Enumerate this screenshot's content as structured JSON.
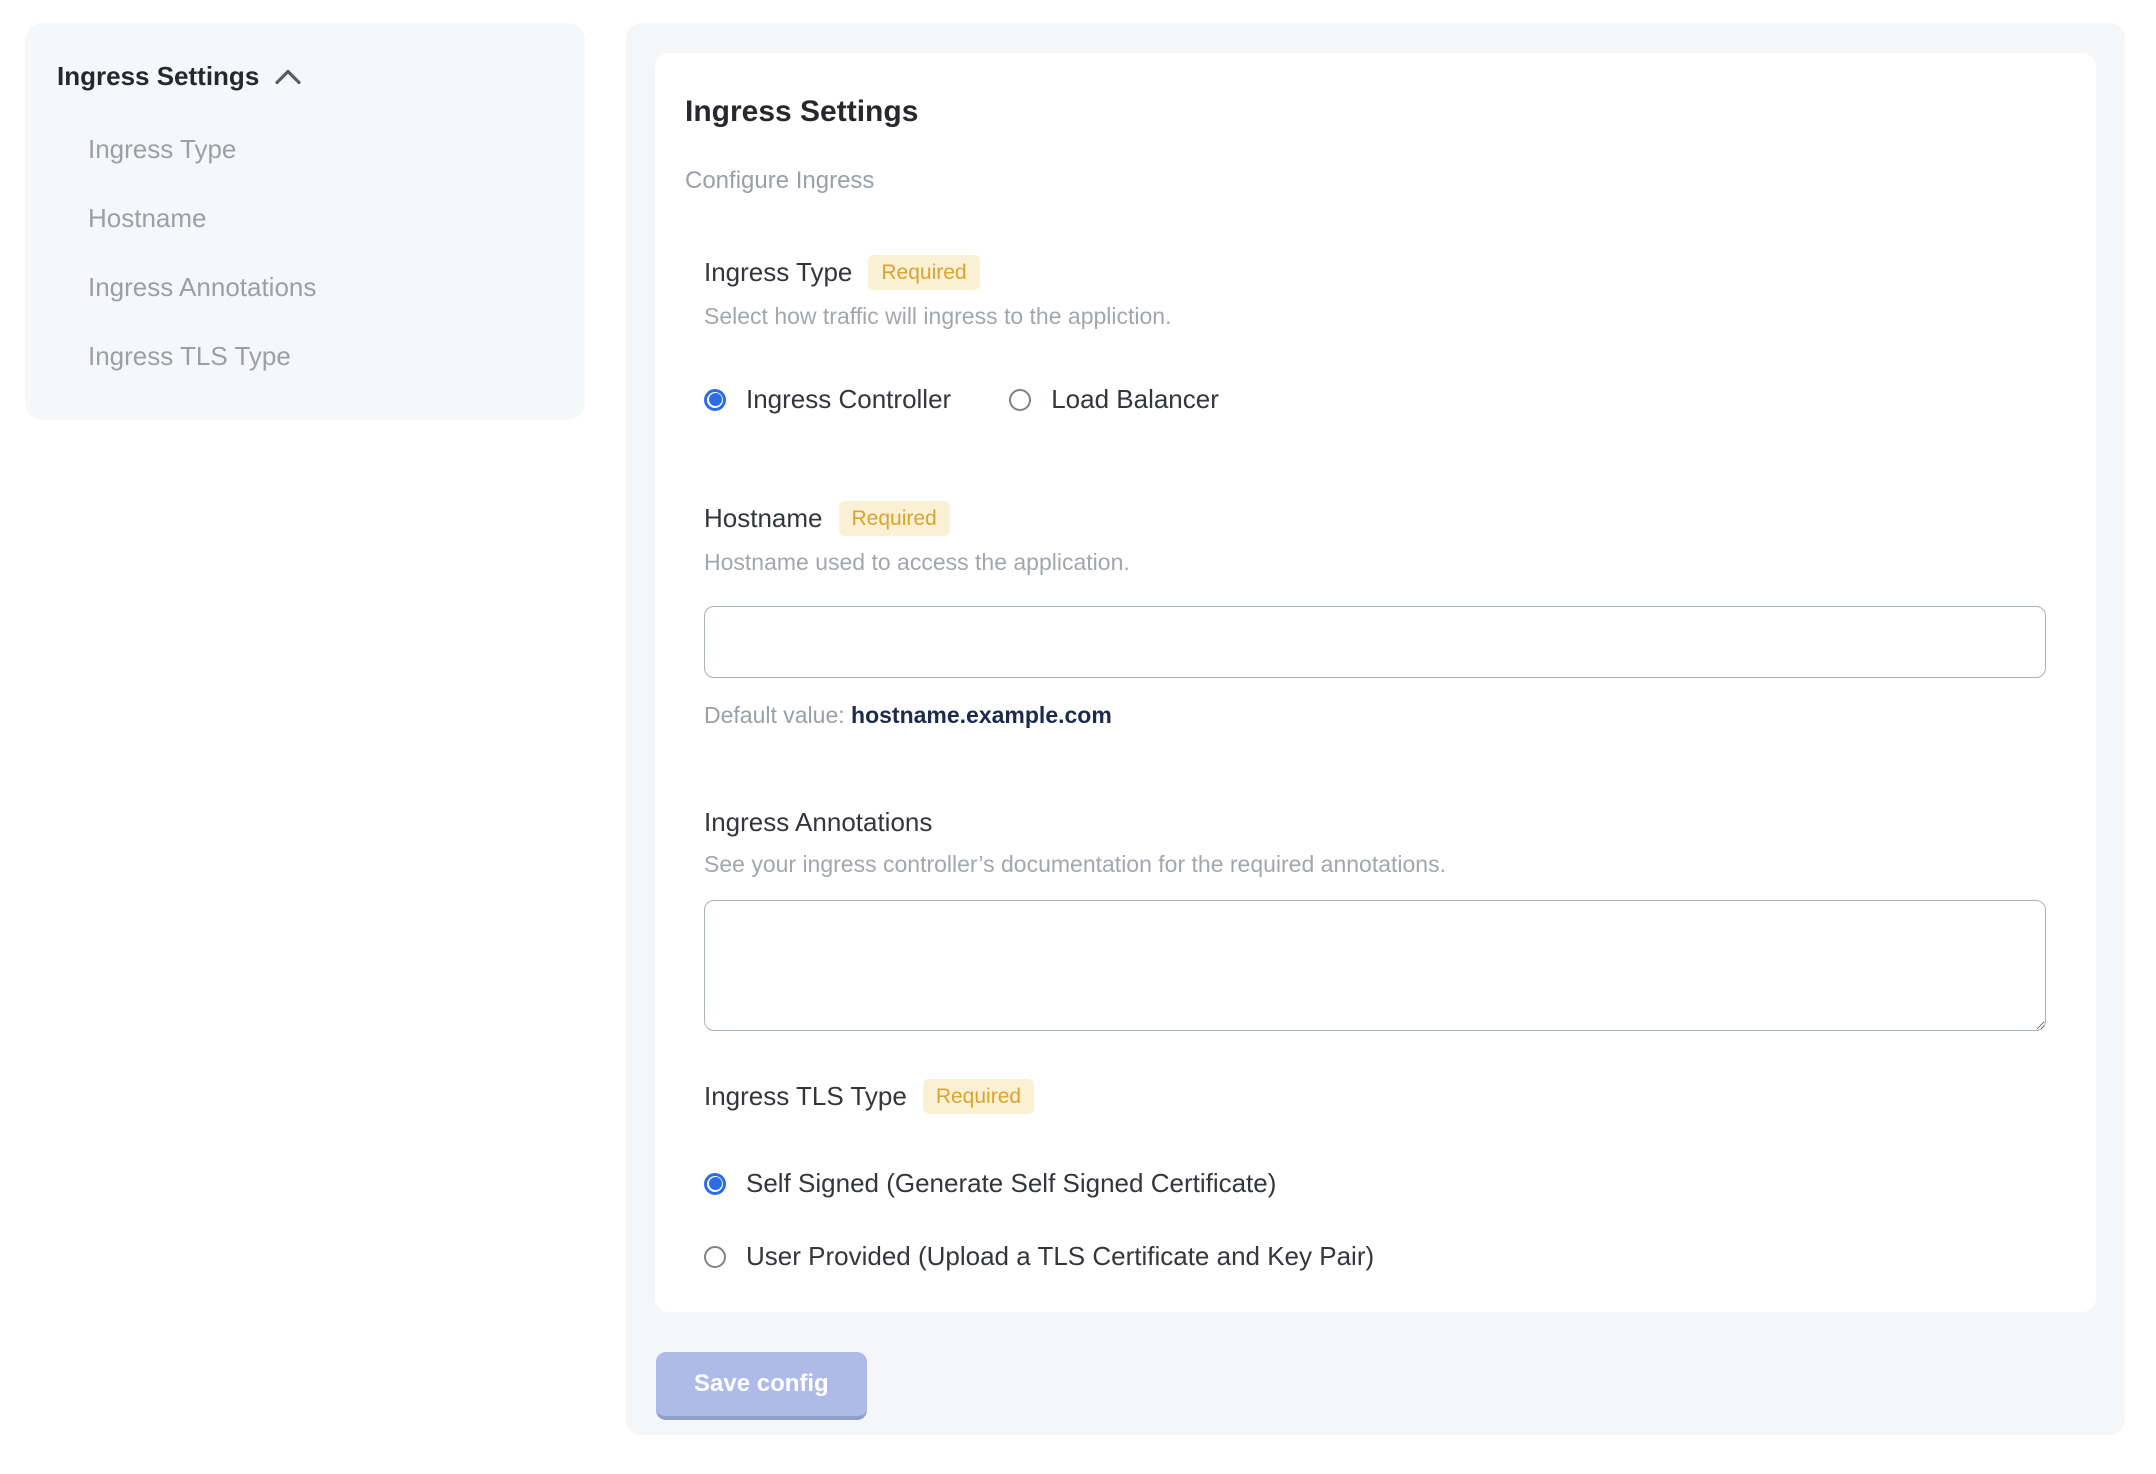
{
  "colors": {
    "page_background": "#ffffff",
    "sidebar_background": "#f6f7f9",
    "panel_background": "#f5f6f8",
    "card_background": "#ffffff",
    "heading_text": "#26282c",
    "label_text": "#33363b",
    "muted_text": "#9ba0a6",
    "badge_background": "#faf0d3",
    "badge_text": "#dda32f",
    "radio_selected": "#2b6de9",
    "radio_unselected_border": "#7f8388",
    "input_border": "#abb1b8",
    "default_value_text": "#1c2b4d",
    "save_button_background": "#aebbe9",
    "save_button_edge": "#8f9ecb"
  },
  "sidebar": {
    "title": "Ingress Settings",
    "collapse_icon": "chevron-up-icon",
    "items": [
      {
        "label": "Ingress Type"
      },
      {
        "label": "Hostname"
      },
      {
        "label": "Ingress Annotations"
      },
      {
        "label": "Ingress TLS Type"
      }
    ]
  },
  "main": {
    "title": "Ingress Settings",
    "subtitle": "Configure Ingress",
    "sections": {
      "ingress_type": {
        "label": "Ingress Type",
        "badge": "Required",
        "description": "Select how traffic will ingress to the appliction.",
        "options": [
          {
            "label": "Ingress Controller",
            "selected": true
          },
          {
            "label": "Load Balancer",
            "selected": false
          }
        ]
      },
      "hostname": {
        "label": "Hostname",
        "badge": "Required",
        "description": "Hostname used to access the application.",
        "input_value": "",
        "default_label": "Default value:",
        "default_value": "hostname.example.com"
      },
      "ingress_annotations": {
        "label": "Ingress Annotations",
        "description": "See your ingress controller’s documentation for the required annotations.",
        "textarea_value": ""
      },
      "ingress_tls_type": {
        "label": "Ingress TLS Type",
        "badge": "Required",
        "options": [
          {
            "label": "Self Signed (Generate Self Signed Certificate)",
            "selected": true
          },
          {
            "label": "User Provided (Upload a TLS Certificate and Key Pair)",
            "selected": false
          }
        ]
      }
    },
    "save_button": "Save config"
  }
}
